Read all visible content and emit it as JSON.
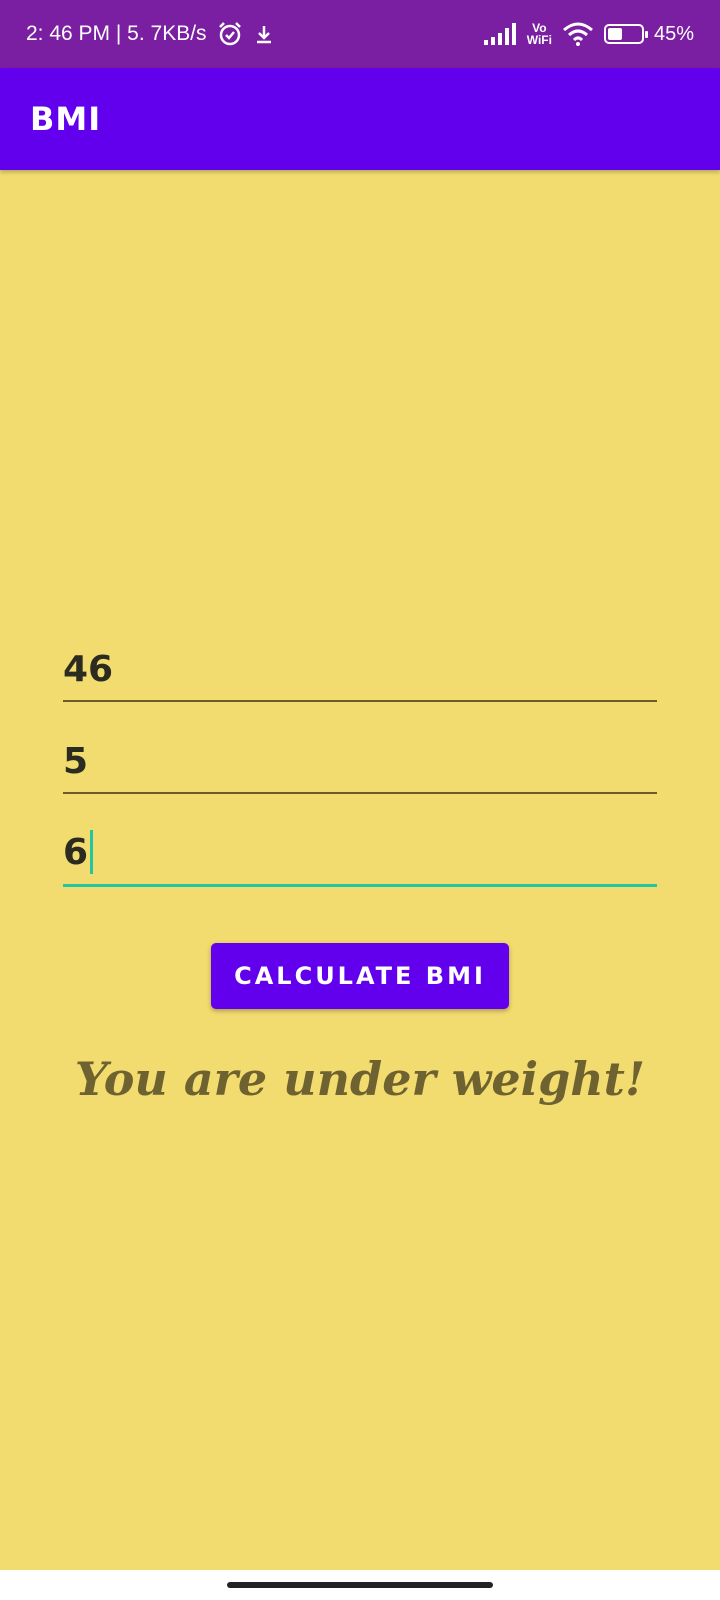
{
  "status_bar": {
    "time_speed": "2: 46 PM | 5. 7KB/s",
    "vo": "Vo",
    "wifi_label": "WiFi",
    "battery_percent": "45%",
    "battery_level": 0.45,
    "icons": [
      "alarm-icon",
      "download-icon",
      "signal-icon",
      "wifi-icon",
      "battery-icon"
    ]
  },
  "app_bar": {
    "title": "BMI"
  },
  "form": {
    "weight_value": "46",
    "height_feet_value": "5",
    "height_inches_value": "6"
  },
  "button": {
    "label": "CALCULATE BMI"
  },
  "result": {
    "text": "You are under weight!"
  },
  "colors": {
    "status_bar": "#7b1fa2",
    "app_bar": "#6200ee",
    "background": "#f2dc70",
    "accent": "#22c7a0",
    "result_text": "#6e6230"
  }
}
